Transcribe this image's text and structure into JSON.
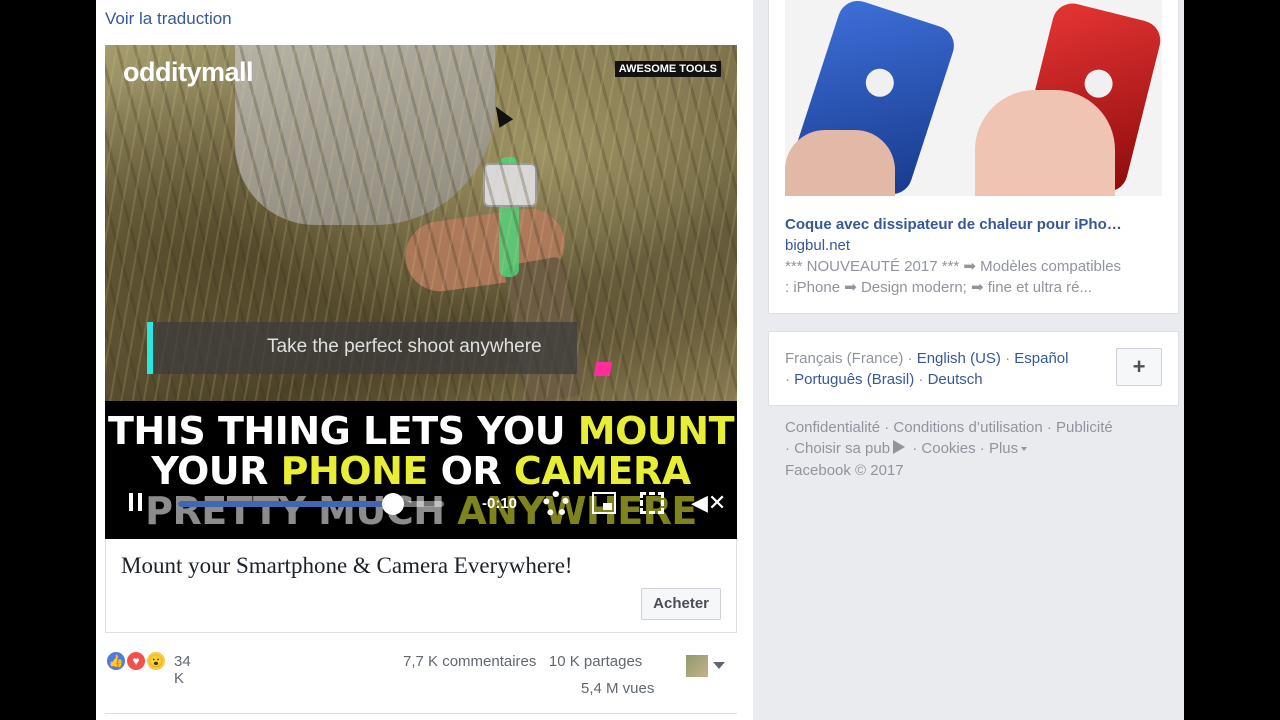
{
  "feed": {
    "see_translation": "Voir la traduction",
    "video": {
      "brand_logo": "odditymall",
      "badge": "AWESOME TOOLS",
      "caption": "Take the perfect shoot anywhere",
      "headline": {
        "line1_white": "THIS THING LETS YOU ",
        "line1_yellow": "MOUNT",
        "line2_white1": "YOUR ",
        "line2_yellow1": "PHONE",
        "line2_white2": " OR ",
        "line2_yellow2": "CAMERA",
        "line3_white": "PRETTY MUCH ",
        "line3_yellow": "ANYWHERE"
      },
      "controls": {
        "time_remaining": "-0:10",
        "progress_fraction": 0.81,
        "mute_glyph": "✕"
      }
    },
    "ad_title": "Mount your Smartphone & Camera Everywhere!",
    "buy_label": "Acheter",
    "reactions": {
      "count": "34 K",
      "types": [
        "like",
        "love",
        "wow"
      ]
    },
    "stats": {
      "comments": "7,7 K commentaires",
      "shares": "10 K partages",
      "views": "5,4 M vues"
    }
  },
  "sidebar": {
    "ad": {
      "headline": "Coque avec dissipateur de chaleur pour iPho…",
      "domain": "bigbul.net",
      "desc_line1": "*** NOUVEAUTÉ 2017 *** ➡ Modèles compatibles",
      "desc_line2": ": iPhone ➡ Design modern; ➡ fine et ultra ré..."
    },
    "languages": {
      "current": "Français (France)",
      "items": [
        "English (US)",
        "Español",
        "Português (Brasil)",
        "Deutsch"
      ],
      "add_label": "+"
    },
    "footer": {
      "privacy": "Confidentialité",
      "terms": "Conditions d’utilisation",
      "advertising": "Publicité",
      "adchoices": "Choisir sa pub",
      "cookies": "Cookies",
      "more": "Plus",
      "copyright": "Facebook © 2017"
    }
  },
  "colors": {
    "link": "#365899",
    "muted": "#90949c",
    "accent_yellow": "#e8ee35",
    "progress": "#4267b2",
    "page_bg": "#e9ebee"
  }
}
